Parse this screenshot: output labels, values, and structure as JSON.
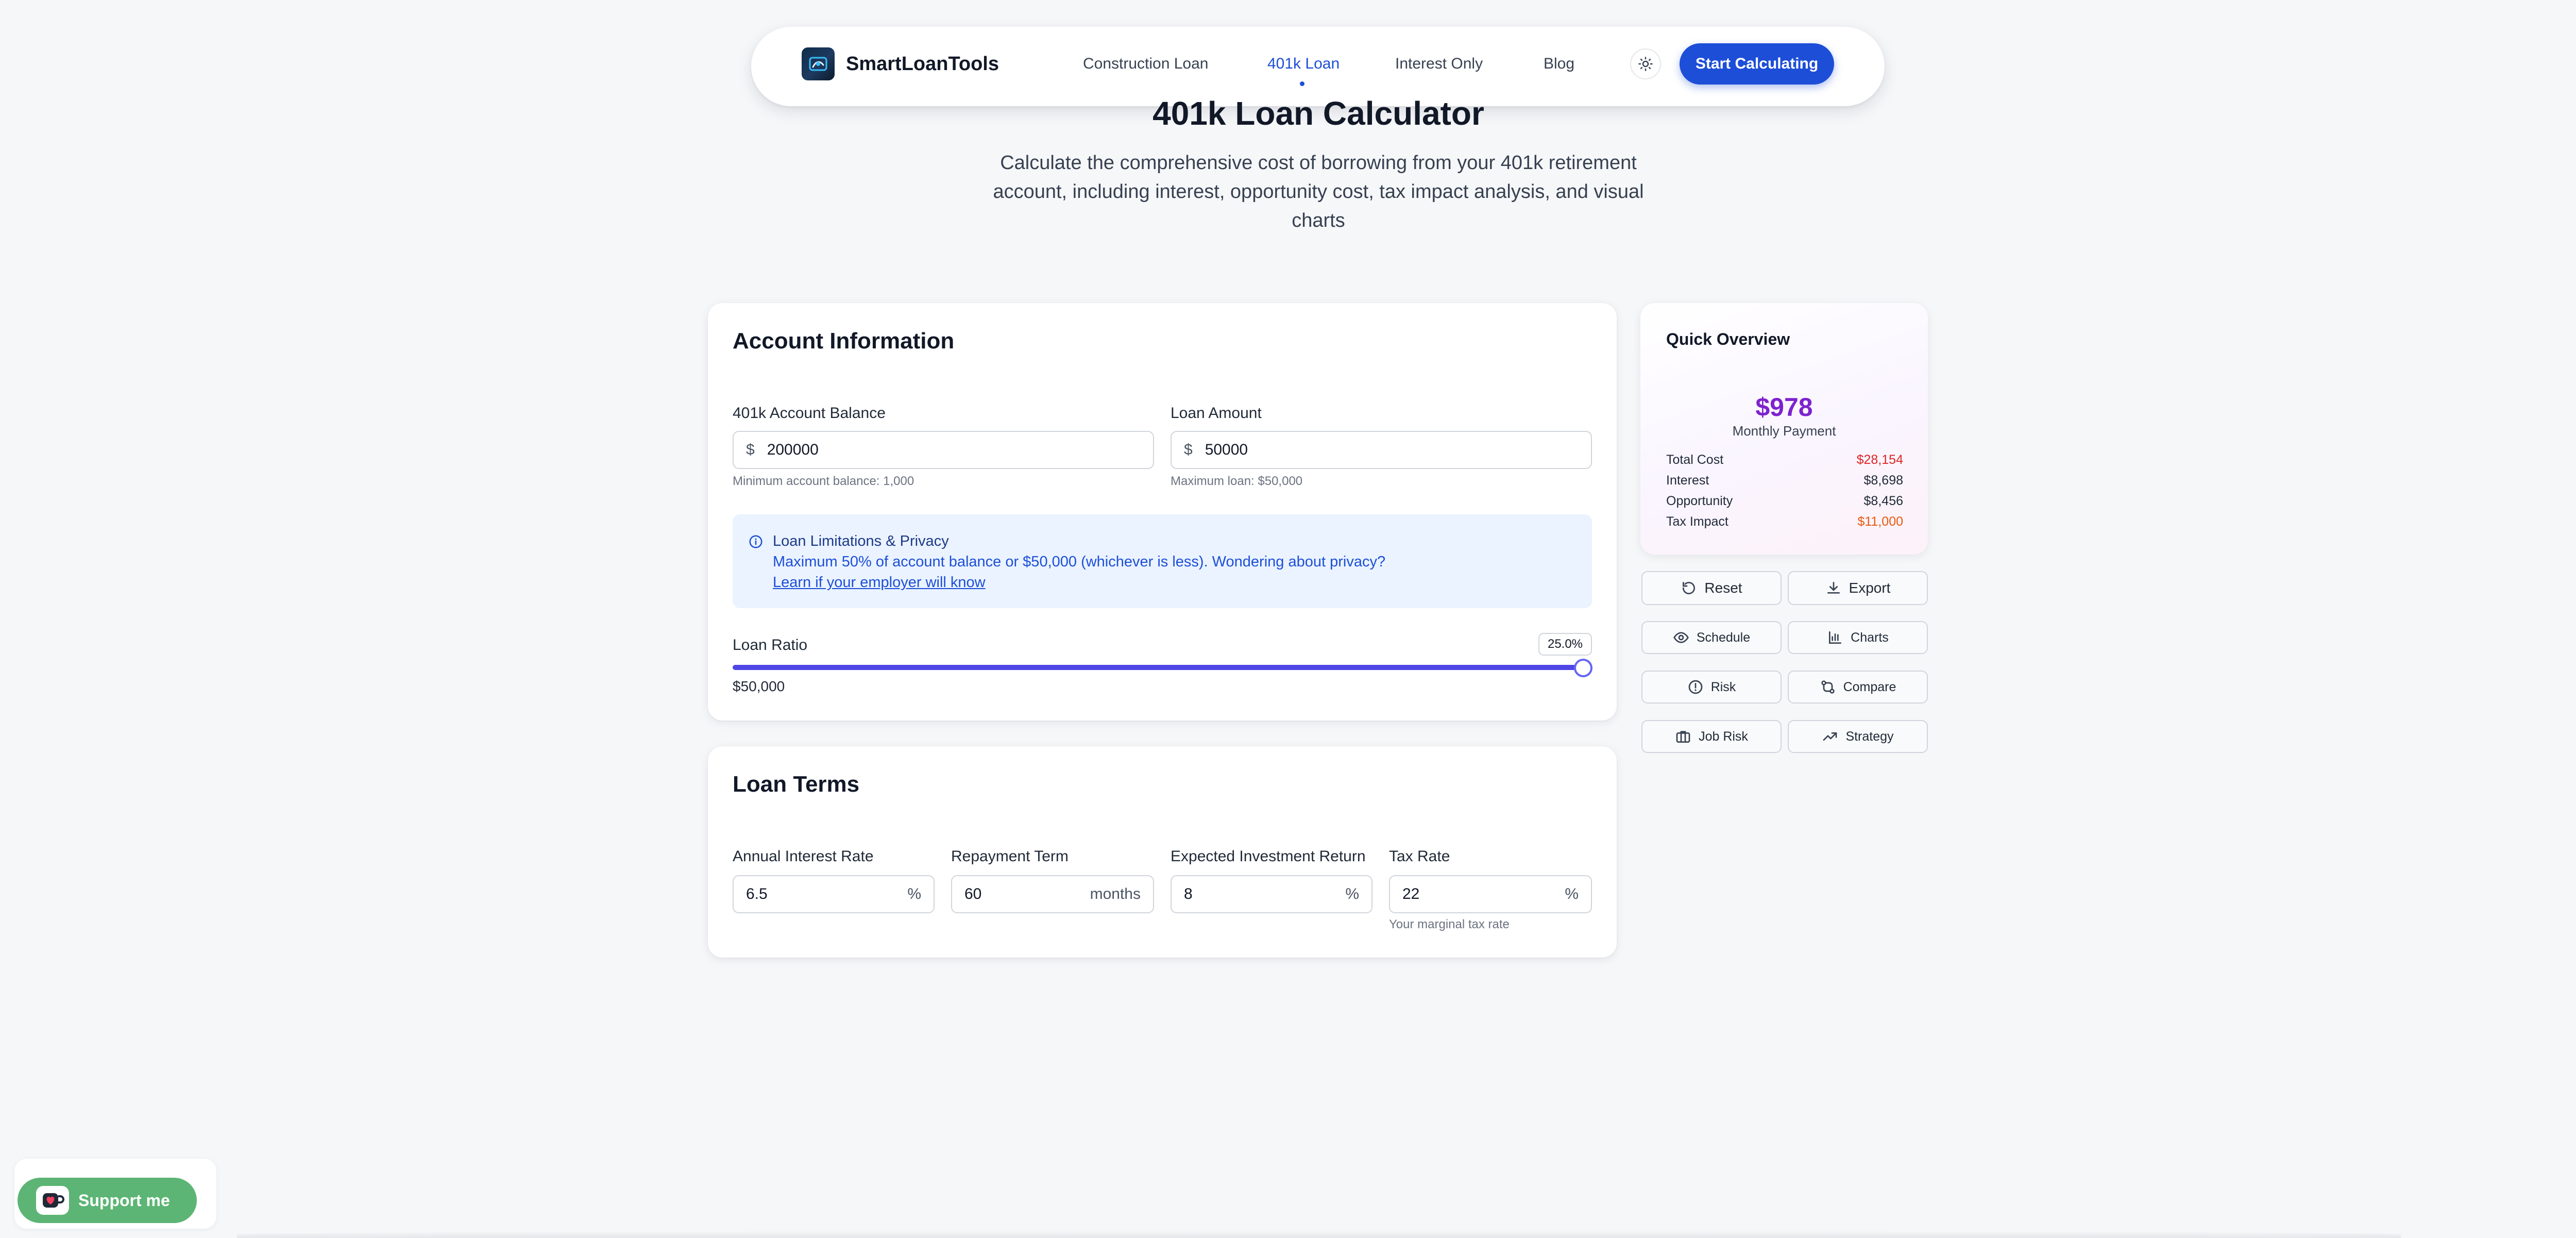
{
  "nav": {
    "brand": "SmartLoanTools",
    "links": [
      "Construction Loan",
      "401k Loan",
      "Interest Only",
      "Blog"
    ],
    "active_link": "401k Loan",
    "cta": "Start Calculating"
  },
  "hero": {
    "title": "401k Loan Calculator",
    "subtitle_lines": [
      "Calculate the comprehensive cost of borrowing from your 401k retirement",
      "account, including interest, opportunity cost, tax impact analysis, and visual",
      "charts"
    ]
  },
  "account": {
    "title": "Account Information",
    "balance_label": "401k Account Balance",
    "balance_prefix": "$",
    "balance_value": "200000",
    "balance_hint": "Minimum account balance: 1,000",
    "loan_label": "Loan Amount",
    "loan_prefix": "$",
    "loan_value": "50000",
    "loan_hint": "Maximum loan: $50,000",
    "info_title": "Loan Limitations & Privacy",
    "info_text": "Maximum 50% of account balance or $50,000 (whichever is less). Wondering about privacy?",
    "info_link": "Learn if your employer will know",
    "ratio_label": "Loan Ratio",
    "ratio_badge": "25.0%",
    "slider_fraction": 1.0,
    "slider_amount": "$50,000"
  },
  "terms": {
    "title": "Loan Terms",
    "rate_label": "Annual Interest Rate",
    "rate_value": "6.5",
    "rate_suffix": "%",
    "term_label": "Repayment Term",
    "term_value": "60",
    "term_suffix": "months",
    "return_label": "Expected Investment Return",
    "return_value": "8",
    "return_suffix": "%",
    "tax_label": "Tax Rate",
    "tax_value": "22",
    "tax_suffix": "%",
    "tax_hint": "Your marginal tax rate"
  },
  "overview": {
    "title": "Quick Overview",
    "amount": "$978",
    "amount_label": "Monthly Payment",
    "rows": [
      {
        "label": "Total Cost",
        "value": "$28,154",
        "color": "#dc2626"
      },
      {
        "label": "Interest",
        "value": "$8,698",
        "color": "#111827"
      },
      {
        "label": "Opportunity",
        "value": "$8,456",
        "color": "#111827"
      },
      {
        "label": "Tax Impact",
        "value": "$11,000",
        "color": "#ea580c"
      }
    ]
  },
  "actions": {
    "reset": "Reset",
    "export": "Export",
    "schedule": "Schedule",
    "charts": "Charts",
    "risk": "Risk",
    "compare": "Compare",
    "job_risk": "Job Risk",
    "strategy": "Strategy"
  },
  "support": {
    "label": "Support me"
  },
  "colors": {
    "accent": "#1d4ed8",
    "purple": "#7e22ce",
    "slider": "#4f46e5",
    "support_green": "#5cb574"
  },
  "icons": [
    "sun-icon",
    "info-icon",
    "reset-icon",
    "download-icon",
    "eye-icon",
    "bar-chart-icon",
    "alert-circle-icon",
    "compare-icon",
    "briefcase-icon",
    "trending-up-icon",
    "qr-grid-icon",
    "translate-icon",
    "coffee-cup-icon"
  ]
}
